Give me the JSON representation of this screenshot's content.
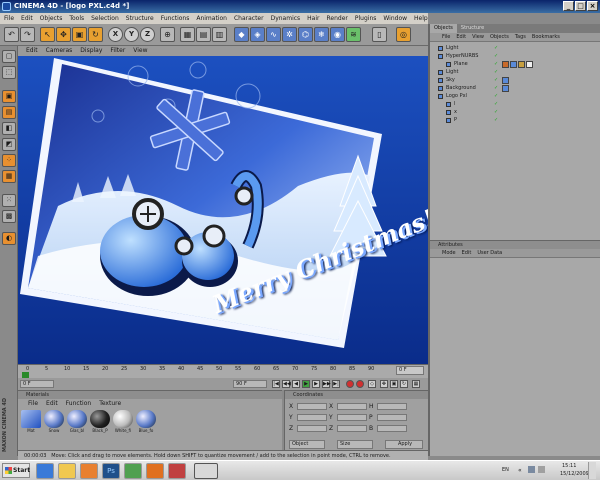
{
  "window": {
    "title": "CINEMA 4D - [logo PXL.c4d *]"
  },
  "main_menu": [
    "File",
    "Edit",
    "Objects",
    "Tools",
    "Selection",
    "Structure",
    "Functions",
    "Animation",
    "Character",
    "Dynamics",
    "Hair",
    "Render",
    "Plugins",
    "Window",
    "Help"
  ],
  "toolbar": {
    "axis_x": "X",
    "axis_y": "Y",
    "axis_z": "Z"
  },
  "viewport": {
    "menu": [
      "Edit",
      "Cameras",
      "Display",
      "Filter",
      "View"
    ],
    "greeting": "Merry Christmas!!!"
  },
  "timeline": {
    "ticks": [
      "0",
      "5",
      "10",
      "15",
      "20",
      "25",
      "30",
      "35",
      "40",
      "45",
      "50",
      "55",
      "60",
      "65",
      "70",
      "75",
      "80",
      "85",
      "90"
    ],
    "end_frame": "0 F",
    "start_field": "0 F",
    "end_field": "90 F"
  },
  "materials": {
    "title": "Materials",
    "menu": [
      "File",
      "Edit",
      "Function",
      "Texture"
    ],
    "items": [
      "Mat",
      "Snow",
      "Glas_bl",
      "Black_P",
      "White_fi",
      "Blue_fo"
    ]
  },
  "coordinates": {
    "title": "Coordinates",
    "rows": [
      {
        "a": "X",
        "b": "X",
        "c": "H"
      },
      {
        "a": "Y",
        "b": "Y",
        "c": "P"
      },
      {
        "a": "Z",
        "b": "Z",
        "c": "B"
      }
    ],
    "mode_select": "Object",
    "size_select": "Size",
    "apply": "Apply"
  },
  "objects_panel": {
    "tabs": [
      "Objects",
      "Structure"
    ],
    "menu": [
      "File",
      "Edit",
      "View",
      "Objects",
      "Tags",
      "Bookmarks"
    ],
    "rows": [
      {
        "name": "Light",
        "indent": 0
      },
      {
        "name": "HyperNURBS",
        "indent": 0
      },
      {
        "name": "Plane",
        "indent": 1
      },
      {
        "name": "Light",
        "indent": 0
      },
      {
        "name": "Sky",
        "indent": 0
      },
      {
        "name": "Background",
        "indent": 0
      },
      {
        "name": "Logo Pxl",
        "indent": 0
      },
      {
        "name": "l",
        "indent": 1
      },
      {
        "name": "x",
        "indent": 1
      },
      {
        "name": "P",
        "indent": 1
      }
    ]
  },
  "attributes_panel": {
    "title": "Attributes",
    "menu": [
      "Mode",
      "Edit",
      "User Data"
    ]
  },
  "statusbar": {
    "time": "00:00:03",
    "message": "Move: Click and drag to move elements. Hold down SHIFT to quantize movement / add to the selection in point mode, CTRL to remove."
  },
  "side_brand": "MAXON CINEMA 4D",
  "taskbar": {
    "start": "Start",
    "lang": "EN",
    "time": "15:11",
    "date": "15/12/2009"
  },
  "colors": {
    "viewport_bg": "#1848b0",
    "accent_orange": "#e89030"
  }
}
